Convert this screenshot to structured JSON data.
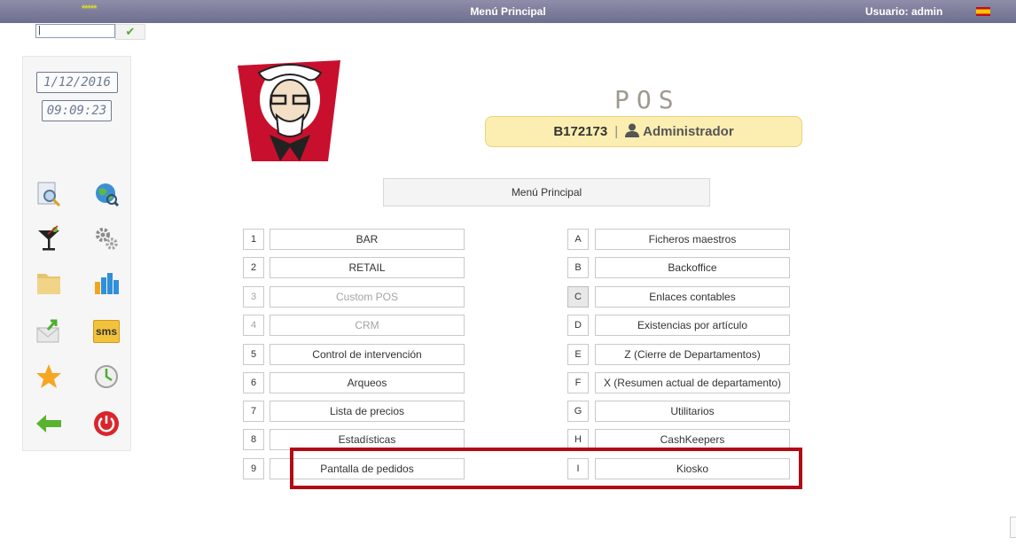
{
  "topbar": {
    "stars": "*****",
    "title": "Menú Principal",
    "user": "Usuario: admin"
  },
  "command": {
    "value": "|",
    "ok_glyph": "✔"
  },
  "sidebar": {
    "date": "1/12/2016",
    "time": "09:09:23",
    "icons": [
      "search-doc-icon",
      "globe-search-icon",
      "cocktail-icon",
      "gears-icon",
      "folder-icon",
      "bar-chart-icon",
      "mail-send-icon",
      "sms-icon",
      "star-icon",
      "clock-icon",
      "back-arrow-icon",
      "power-icon"
    ],
    "sms_label": "sms"
  },
  "header": {
    "pos_title": "POS",
    "terminal_code": "B172173",
    "separator": "|",
    "user_role": "Administrador"
  },
  "menu": {
    "title": "Menú Principal",
    "left": [
      {
        "key": "1",
        "label": "BAR",
        "enabled": true
      },
      {
        "key": "2",
        "label": "RETAIL",
        "enabled": true
      },
      {
        "key": "3",
        "label": "Custom POS",
        "enabled": false
      },
      {
        "key": "4",
        "label": "CRM",
        "enabled": false
      },
      {
        "key": "5",
        "label": "Control de intervención",
        "enabled": true
      },
      {
        "key": "6",
        "label": "Arqueos",
        "enabled": true
      },
      {
        "key": "7",
        "label": "Lista de precios",
        "enabled": true
      },
      {
        "key": "8",
        "label": "Estadísticas",
        "enabled": true
      },
      {
        "key": "9",
        "label": "Pantalla de pedidos",
        "enabled": true
      }
    ],
    "right": [
      {
        "key": "A",
        "label": "Ficheros maestros",
        "enabled": true
      },
      {
        "key": "B",
        "label": "Backoffice",
        "enabled": true
      },
      {
        "key": "C",
        "label": "Enlaces contables",
        "enabled": true,
        "pressed": true
      },
      {
        "key": "D",
        "label": "Existencias por artículo",
        "enabled": true
      },
      {
        "key": "E",
        "label": "Z (Cierre de Departamentos)",
        "enabled": true
      },
      {
        "key": "F",
        "label": "X (Resumen actual de departamento)",
        "enabled": true
      },
      {
        "key": "G",
        "label": "Utilitarios",
        "enabled": true
      },
      {
        "key": "H",
        "label": "CashKeepers",
        "enabled": true
      },
      {
        "key": "I",
        "label": "Kiosko",
        "enabled": true
      }
    ]
  },
  "colors": {
    "topbar": "#7e7e9c",
    "pill": "#fbeeb0",
    "highlight": "#b10b18"
  }
}
